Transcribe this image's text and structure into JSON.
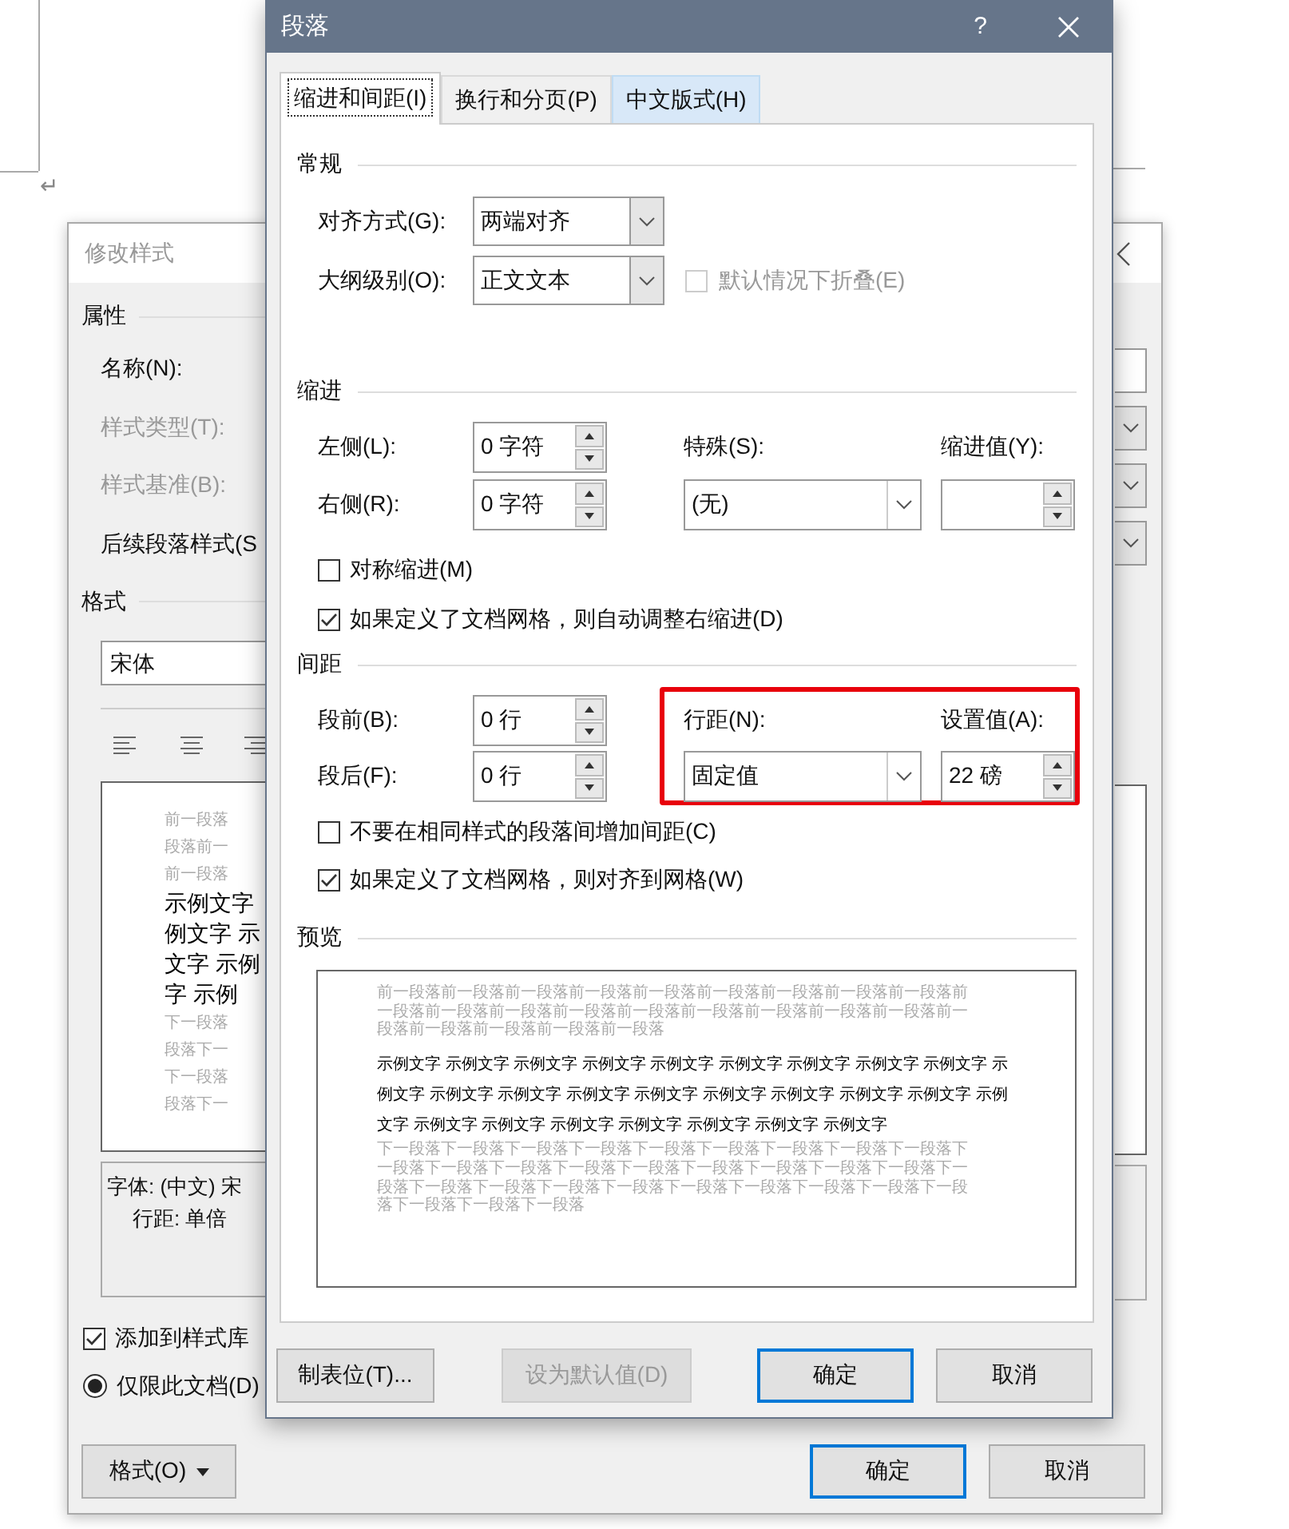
{
  "document": {
    "paragraph_mark": "↵"
  },
  "style_dialog": {
    "title": "修改样式",
    "properties_header": "属性",
    "property_labels": [
      {
        "label": "名称(N):",
        "disabled": false
      },
      {
        "label": "样式类型(T):",
        "disabled": true
      },
      {
        "label": "样式基准(B):",
        "disabled": true
      },
      {
        "label": "后续段落样式(S",
        "disabled": false
      }
    ],
    "format_header": "格式",
    "font_field": "宋体",
    "preview_lines": [
      {
        "kind": "context",
        "text": "前一段落"
      },
      {
        "kind": "context",
        "text": "段落前一"
      },
      {
        "kind": "context",
        "text": "前一段落"
      },
      {
        "kind": "sample",
        "text": "示例文字"
      },
      {
        "kind": "sample",
        "text": "例文字 示"
      },
      {
        "kind": "sample",
        "text": "文字 示例"
      },
      {
        "kind": "sample",
        "text": "字 示例"
      },
      {
        "kind": "context",
        "text": "下一段落"
      },
      {
        "kind": "context",
        "text": "段落下一"
      },
      {
        "kind": "context",
        "text": "下一段落"
      },
      {
        "kind": "context",
        "text": "段落下一"
      }
    ],
    "description_lines": [
      "字体: (中文) 宋",
      "行距: 单倍"
    ],
    "add_to_gallery": {
      "label": "添加到样式库",
      "checked": true
    },
    "document_only": {
      "label": "仅限此文档(D)",
      "selected": true
    },
    "format_button": "格式(O)",
    "ok_button": "确定",
    "cancel_button": "取消"
  },
  "paragraph_dialog": {
    "title": "段落",
    "help_button": "?",
    "tabs": [
      {
        "label": "缩进和间距(I)",
        "selected": true,
        "hovered": false
      },
      {
        "label": "换行和分页(P)",
        "selected": false,
        "hovered": false
      },
      {
        "label": "中文版式(H)",
        "selected": false,
        "hovered": true
      }
    ],
    "general": {
      "header": "常规",
      "alignment": {
        "label": "对齐方式(G):",
        "value": "两端对齐"
      },
      "outline_level": {
        "label": "大纲级别(O):",
        "value": "正文文本"
      },
      "collapse": {
        "label": "默认情况下折叠(E)",
        "checked": false,
        "disabled": true
      }
    },
    "indentation": {
      "header": "缩进",
      "left": {
        "label": "左侧(L):",
        "value": "0 字符"
      },
      "right": {
        "label": "右侧(R):",
        "value": "0 字符"
      },
      "special": {
        "label": "特殊(S):",
        "value": "(无)"
      },
      "by": {
        "label": "缩进值(Y):"
      },
      "checkboxes": [
        {
          "label": "对称缩进(M)",
          "checked": false
        },
        {
          "label": "如果定义了文档网格，则自动调整右缩进(D)",
          "checked": true
        }
      ]
    },
    "spacing": {
      "header": "间距",
      "highlighted": true,
      "before": {
        "label": "段前(B):",
        "value": "0 行"
      },
      "after": {
        "label": "段后(F):",
        "value": "0 行"
      },
      "line_spacing": {
        "label": "行距(N):",
        "value": "固定值"
      },
      "at": {
        "label": "设置值(A):",
        "value": "22 磅"
      },
      "checkboxes": [
        {
          "label": "不要在相同样式的段落间增加间距(C)",
          "checked": false
        },
        {
          "label": "如果定义了文档网格，则对齐到网格(W)",
          "checked": true
        }
      ]
    },
    "preview": {
      "header": "预览",
      "lines": [
        {
          "kind": "context",
          "text": "前一段落前一段落前一段落前一段落前一段落前一段落前一段落前一段落前一段落前"
        },
        {
          "kind": "context",
          "text": "一段落前一段落前一段落前一段落前一段落前一段落前一段落前一段落前一段落前一"
        },
        {
          "kind": "context",
          "text": "段落前一段落前一段落前一段落前一段落"
        },
        {
          "kind": "sample",
          "text": "示例文字 示例文字 示例文字 示例文字 示例文字 示例文字 示例文字 示例文字 示例文字 示"
        },
        {
          "kind": "sample",
          "text": "例文字 示例文字 示例文字 示例文字 示例文字 示例文字 示例文字 示例文字 示例文字 示例"
        },
        {
          "kind": "sample",
          "text": "文字 示例文字 示例文字 示例文字 示例文字 示例文字 示例文字 示例文字"
        },
        {
          "kind": "context",
          "text": "下一段落下一段落下一段落下一段落下一段落下一段落下一段落下一段落下一段落下"
        },
        {
          "kind": "context",
          "text": "一段落下一段落下一段落下一段落下一段落下一段落下一段落下一段落下一段落下一"
        },
        {
          "kind": "context",
          "text": "段落下一段落下一段落下一段落下一段落下一段落下一段落下一段落下一段落下一段"
        },
        {
          "kind": "context",
          "text": "落下一段落下一段落下一段落"
        }
      ]
    },
    "buttons": [
      {
        "label": "制表位(T)...",
        "disabled": false,
        "default": false
      },
      {
        "label": "设为默认值(D)",
        "disabled": true,
        "default": false
      },
      {
        "label": "确定",
        "disabled": false,
        "default": true
      },
      {
        "label": "取消",
        "disabled": false,
        "default": false
      }
    ]
  }
}
